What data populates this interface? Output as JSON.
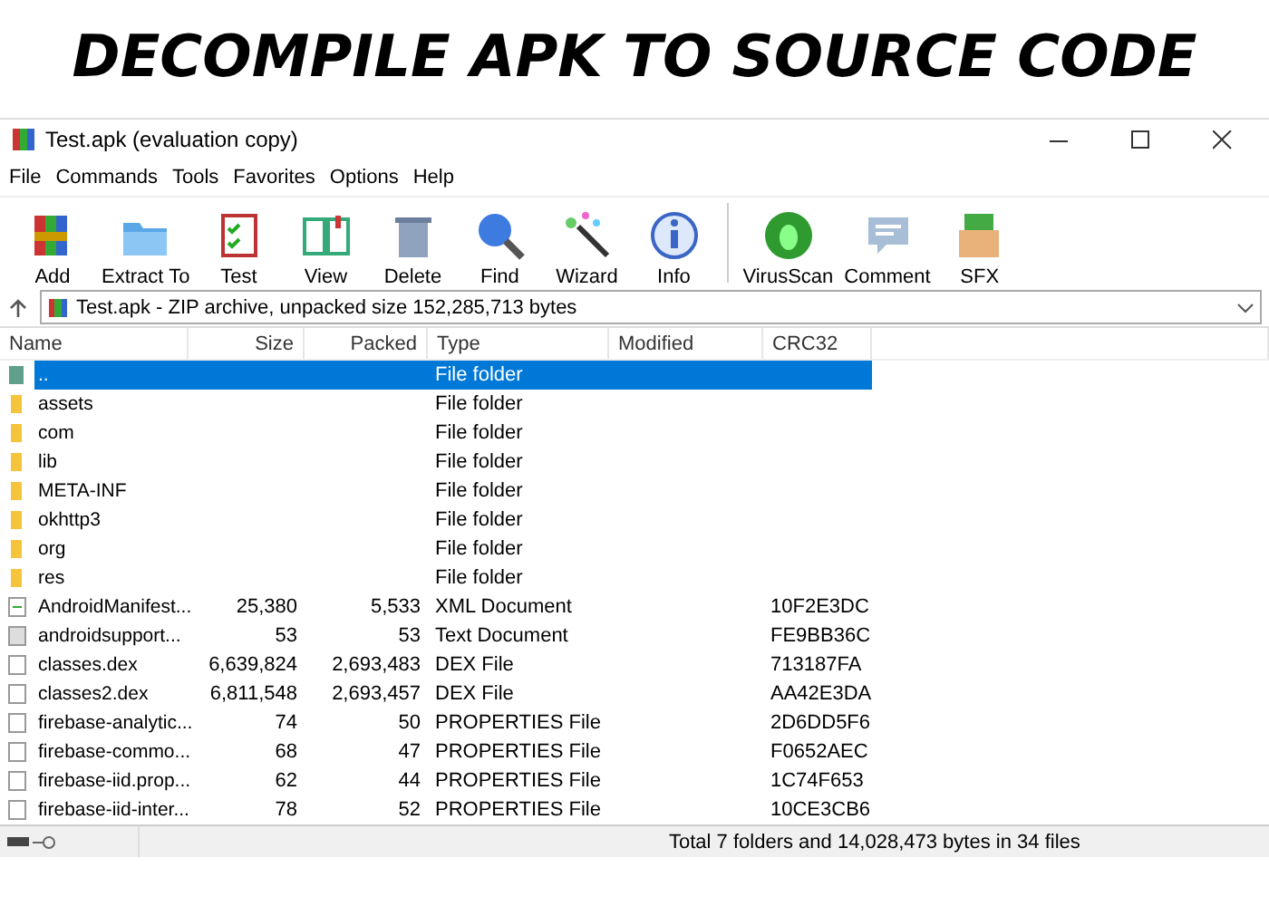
{
  "banner": {
    "title": "DECOMPILE APK TO SOURCE CODE"
  },
  "window": {
    "title": "Test.apk (evaluation copy)"
  },
  "menu": [
    "File",
    "Commands",
    "Tools",
    "Favorites",
    "Options",
    "Help"
  ],
  "toolbar": [
    {
      "label": "Add",
      "kind": "add"
    },
    {
      "label": "Extract To",
      "kind": "extract"
    },
    {
      "label": "Test",
      "kind": "test"
    },
    {
      "label": "View",
      "kind": "view"
    },
    {
      "label": "Delete",
      "kind": "delete"
    },
    {
      "label": "Find",
      "kind": "find"
    },
    {
      "label": "Wizard",
      "kind": "wizard"
    },
    {
      "label": "Info",
      "kind": "info"
    },
    {
      "label": "VirusScan",
      "kind": "virus"
    },
    {
      "label": "Comment",
      "kind": "comment"
    },
    {
      "label": "SFX",
      "kind": "sfx"
    }
  ],
  "address": {
    "value": "Test.apk - ZIP archive, unpacked size 152,285,713 bytes"
  },
  "table": {
    "columns": [
      "Name",
      "Size",
      "Packed",
      "Type",
      "Modified",
      "CRC32"
    ],
    "rows": [
      {
        "kind": "up",
        "name": "..",
        "size": "",
        "packed": "",
        "type": "File folder",
        "crc": "",
        "selected": true
      },
      {
        "kind": "folder",
        "name": "assets",
        "type": "File folder",
        "selected": false
      },
      {
        "kind": "folder",
        "name": "com",
        "type": "File folder",
        "selected": false
      },
      {
        "kind": "folder",
        "name": "lib",
        "type": "File folder",
        "selected": false
      },
      {
        "kind": "folder",
        "name": "META-INF",
        "type": "File folder",
        "selected": false
      },
      {
        "kind": "folder",
        "name": "okhttp3",
        "type": "File folder",
        "selected": false
      },
      {
        "kind": "folder",
        "name": "org",
        "type": "File folder",
        "selected": false
      },
      {
        "kind": "folder",
        "name": "res",
        "type": "File folder",
        "selected": false
      },
      {
        "kind": "xml",
        "name": "AndroidManifest...",
        "size": "25,380",
        "packed": "5,533",
        "type": "XML Document",
        "crc": "10F2E3DC",
        "selected": false
      },
      {
        "kind": "text",
        "name": "androidsupport...",
        "size": "53",
        "packed": "53",
        "type": "Text Document",
        "crc": "FE9BB36C",
        "selected": false
      },
      {
        "kind": "file",
        "name": "classes.dex",
        "size": "6,639,824",
        "packed": "2,693,483",
        "type": "DEX File",
        "crc": "713187FA",
        "selected": false
      },
      {
        "kind": "file",
        "name": "classes2.dex",
        "size": "6,811,548",
        "packed": "2,693,457",
        "type": "DEX File",
        "crc": "AA42E3DA",
        "selected": false
      },
      {
        "kind": "file",
        "name": "firebase-analytic...",
        "size": "74",
        "packed": "50",
        "type": "PROPERTIES File",
        "crc": "2D6DD5F6",
        "selected": false
      },
      {
        "kind": "file",
        "name": "firebase-commo...",
        "size": "68",
        "packed": "47",
        "type": "PROPERTIES File",
        "crc": "F0652AEC",
        "selected": false
      },
      {
        "kind": "file",
        "name": "firebase-iid.prop...",
        "size": "62",
        "packed": "44",
        "type": "PROPERTIES File",
        "crc": "1C74F653",
        "selected": false
      },
      {
        "kind": "file",
        "name": "firebase-iid-inter...",
        "size": "78",
        "packed": "52",
        "type": "PROPERTIES File",
        "crc": "10CE3CB6",
        "selected": false
      }
    ]
  },
  "status_bar": {
    "text": "Total 7 folders and 14,028,473 bytes in 34 files"
  }
}
